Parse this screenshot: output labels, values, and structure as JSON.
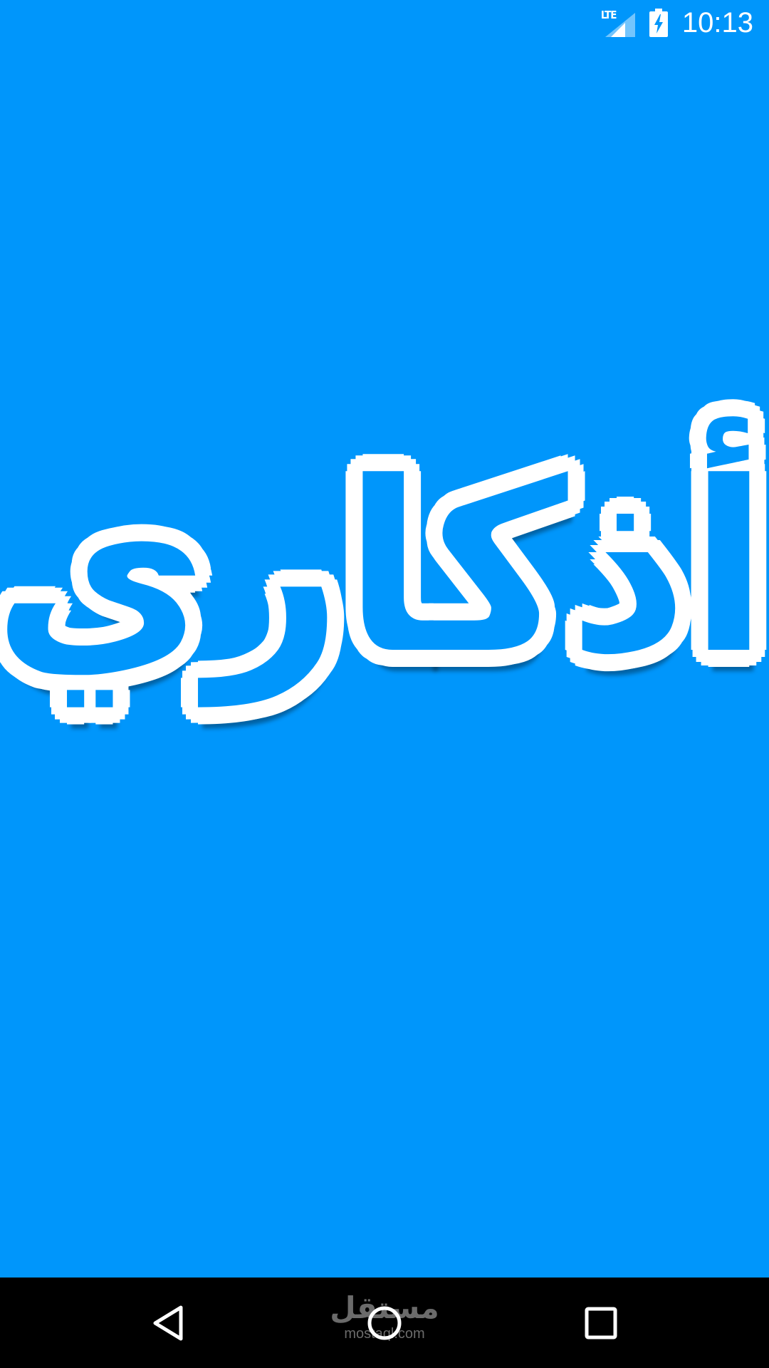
{
  "status_bar": {
    "network_label": "LTE",
    "time": "10:13",
    "icons": [
      "lte-signal-icon",
      "battery-charging-icon"
    ]
  },
  "splash": {
    "title": "أذكاري",
    "background_color": "#0096fb",
    "title_fill_color": "#0096fb",
    "title_outline_color": "#ffffff"
  },
  "navigation_bar": {
    "buttons": [
      "back-icon",
      "home-icon",
      "recents-icon"
    ]
  },
  "watermark": {
    "arabic": "مستقل",
    "latin": "mostaql.com"
  }
}
